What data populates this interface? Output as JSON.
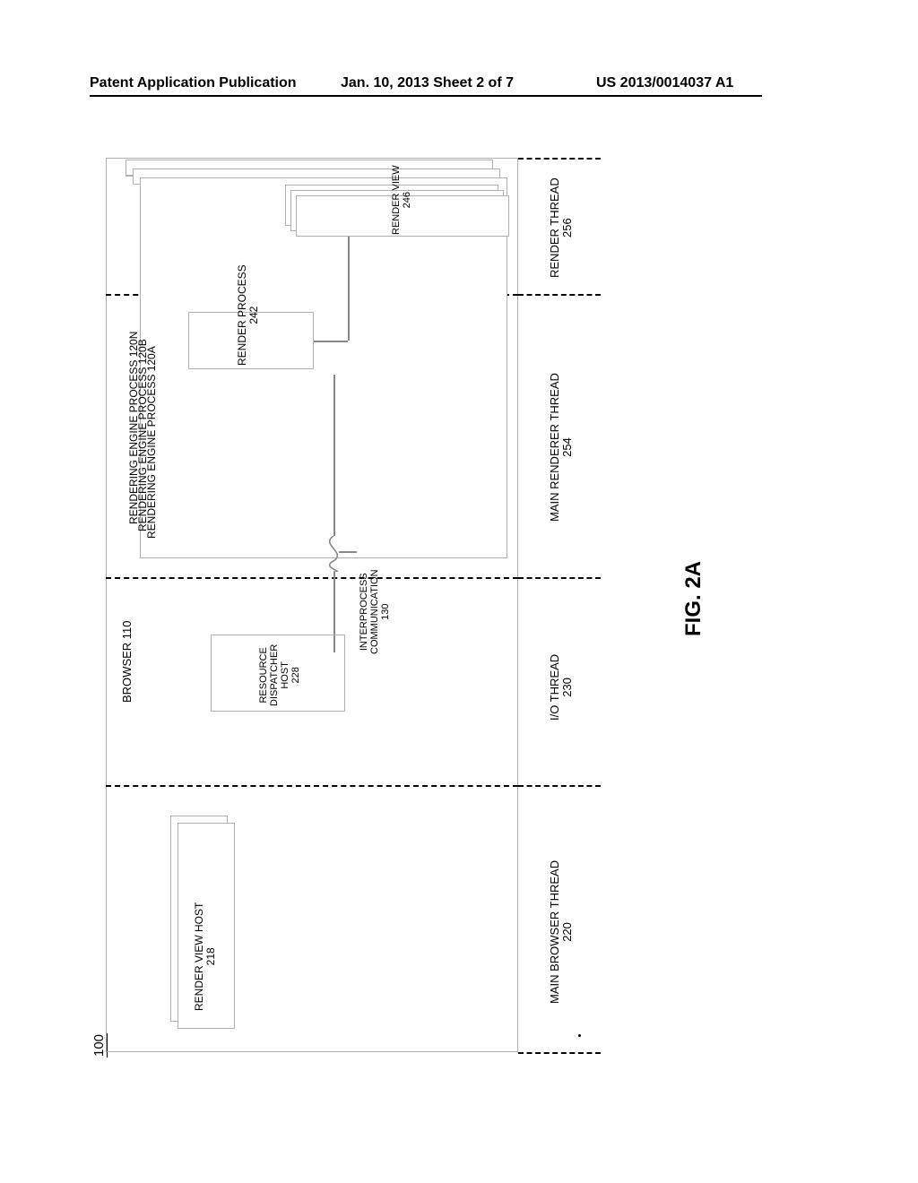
{
  "header": {
    "left": "Patent Application Publication",
    "center": "Jan. 10, 2013  Sheet 2 of 7",
    "right": "US 2013/0014037 A1"
  },
  "diagram": {
    "ref": "100",
    "browser": {
      "label": "BROWSER 110"
    },
    "render_view_host": {
      "line1": "RENDER VIEW HOST",
      "line2": "218"
    },
    "resource_dispatcher_host": {
      "line1": "RESOURCE",
      "line2": "DISPATCHER",
      "line3": "HOST",
      "line4": "228"
    },
    "ipc": {
      "line1": "INTERPROCESS",
      "line2": "COMMUNICATION",
      "line3": "130"
    },
    "engines": {
      "n": "RENDERING ENGINE PROCESS 120N",
      "b": "RENDERING ENGINE PROCESS 120B",
      "a": "RENDERING ENGINE PROCESS 120A"
    },
    "render_process": {
      "line1": "RENDER PROCESS",
      "line2": "242"
    },
    "render_view": {
      "line1": "RENDER VIEW",
      "line2": "246"
    },
    "threads": {
      "main_browser": {
        "line1": "MAIN BROWSER THREAD",
        "line2": "220"
      },
      "io": {
        "line1": "I/O THREAD",
        "line2": "230"
      },
      "main_renderer": {
        "line1": "MAIN RENDERER THREAD",
        "line2": "254"
      },
      "render": {
        "line1": "RENDER THREAD",
        "line2": "256"
      }
    },
    "figure_label": "FIG. 2A"
  }
}
